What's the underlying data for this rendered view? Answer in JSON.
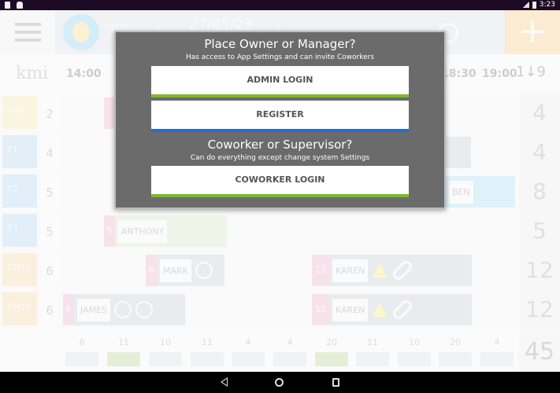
{
  "status_bar": {
    "time": "3:23"
  },
  "app_header": {
    "org_name": "Demo",
    "date": "27/05/23",
    "prev_icon": "‹",
    "next_icon": "›",
    "add_icon": "+",
    "logo_text": "kmi"
  },
  "time_header": {
    "times": [
      "14:00",
      "18:30",
      "19:00"
    ],
    "sort_icon": "1↓9"
  },
  "rows": [
    {
      "role": "BAR",
      "count": "2",
      "total": "4",
      "role_color": "#ffe082"
    },
    {
      "role": "T1",
      "count": "4",
      "total": "4",
      "role_color": "#90caf9"
    },
    {
      "role": "T2",
      "count": "5",
      "total": "8",
      "role_color": "#90caf9"
    },
    {
      "role": "T3",
      "count": "5",
      "total": "5",
      "role_color": "#90caf9"
    },
    {
      "role": "DNT1",
      "count": "6",
      "total": "12",
      "role_color": "#ffcc80"
    },
    {
      "role": "DNT2",
      "count": "6",
      "total": "12",
      "role_color": "#ffcc80"
    }
  ],
  "shifts": {
    "ben": {
      "name": "BEN"
    },
    "anthony": {
      "name": "ANTHONY",
      "length": "5"
    },
    "mark": {
      "name": "MARK",
      "length": "6"
    },
    "james": {
      "name": "JAMES",
      "length": "6"
    },
    "karen1": {
      "name": "KAREN",
      "length": "12"
    },
    "karen2": {
      "name": "KAREN",
      "length": "12"
    }
  },
  "footer": {
    "counts": [
      "6",
      "11",
      "10",
      "11",
      "4",
      "4",
      "20",
      "11",
      "10",
      "20",
      "4"
    ],
    "grand_total": "45"
  },
  "dialog": {
    "owner_title": "Place Owner or Manager?",
    "owner_subtitle": "Has access to App Settings and can invite Coworkers",
    "admin_login_label": "ADMIN LOGIN",
    "register_label": "REGISTER",
    "coworker_title": "Coworker or Supervisor?",
    "coworker_subtitle": "Can do everything except change system Settings",
    "coworker_login_label": "COWORKER LOGIN",
    "accent_green": "#7cb82f",
    "accent_blue": "#1e6fd9"
  }
}
